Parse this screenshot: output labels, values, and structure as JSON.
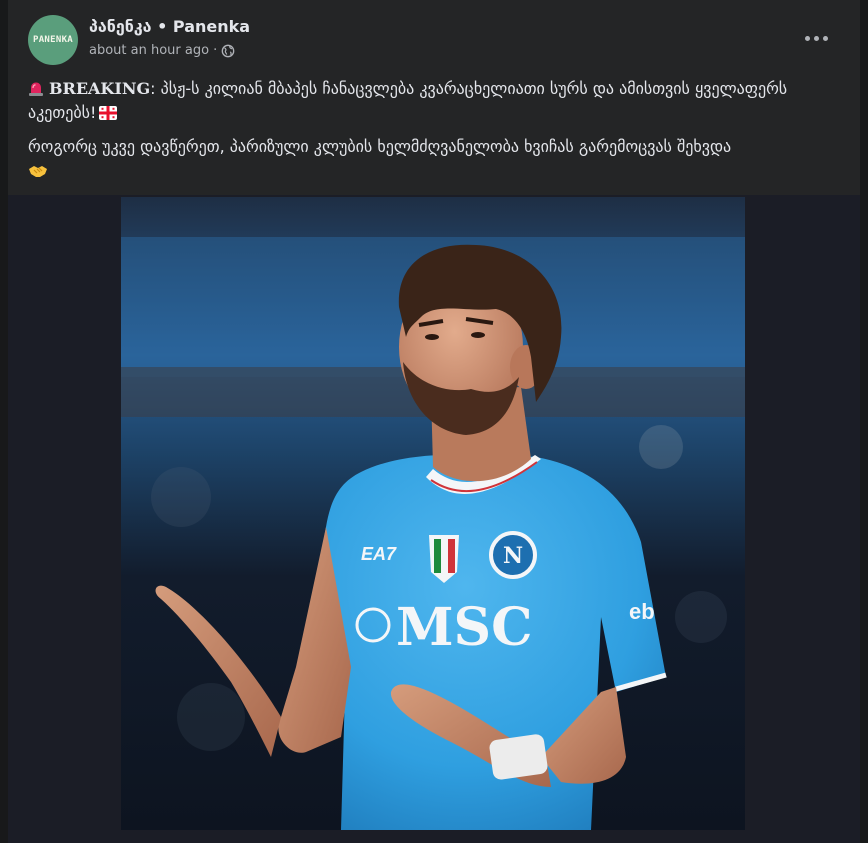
{
  "post": {
    "page_name": "პანენკა • Panenka",
    "avatar_text": "PANENKA",
    "timestamp": "about an hour ago",
    "separator": " · ",
    "privacy_icon": "globe-icon",
    "more_icon": "more-options-icon",
    "lines": [
      {
        "icon": "siren-icon",
        "bold": "BREAKING",
        "text": ": პსჟ-ს კილიან მბაპეს ჩანაცვლება კვარაცხელიათი სურს და ამისთვის ყველაფერს აკეთებს!",
        "trailing_icon": "georgia-flag-icon"
      },
      {
        "text": "როგორც უკვე დავწერეთ, პარიზული კლუბის ხელმძღვანელობა ხვიჩას გარემოცვას შეხვდა",
        "trailing_icon": "handshake-icon"
      }
    ]
  },
  "photo": {
    "jersey_sponsor": "MSC",
    "jersey_brand": "EA7",
    "sleeve_text": "eb",
    "colors": {
      "jersey": "#2f9fe0",
      "background": "#1f3a5a",
      "skin": "#c98f6f",
      "hair": "#3a2418"
    }
  },
  "colors": {
    "card": "#242526",
    "page": "#18191a",
    "text": "#e4e6eb",
    "secondary": "#b0b3b8",
    "avatar": "#5a9e7c"
  }
}
